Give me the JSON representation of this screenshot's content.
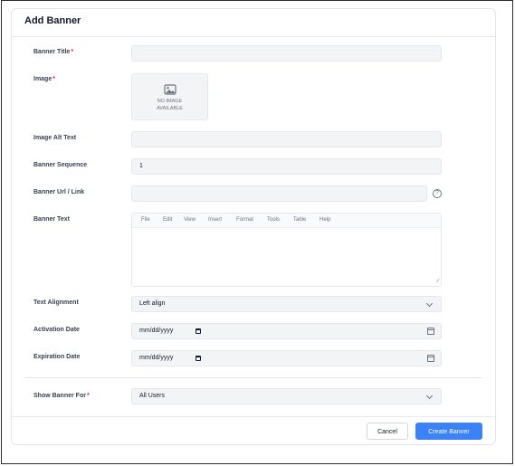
{
  "header": {
    "title": "Add Banner"
  },
  "fields": {
    "banner_title": {
      "label": "Banner Title",
      "required_mark": "*",
      "value": ""
    },
    "image": {
      "label": "Image",
      "required_mark": "*",
      "placeholder_line1": "NO IMAGE",
      "placeholder_line2": "AVAILABLE"
    },
    "image_alt_text": {
      "label": "Image Alt Text",
      "value": ""
    },
    "banner_sequence": {
      "label": "Banner Sequence",
      "value": "1"
    },
    "banner_url": {
      "label": "Banner Url / Link",
      "value": "",
      "help_icon": "question-circle-icon",
      "help_glyph": "?"
    },
    "banner_text": {
      "label": "Banner Text",
      "menu": [
        "File",
        "Edit",
        "View",
        "Insert",
        "Format",
        "Tools",
        "Table",
        "Help"
      ]
    },
    "text_alignment": {
      "label": "Text Alignment",
      "selected": "Left align"
    },
    "activation_date": {
      "label": "Activation Date",
      "placeholder": "mm/dd/yyyy"
    },
    "expiration_date": {
      "label": "Expiration Date",
      "placeholder": "mm/dd/yyyy"
    },
    "show_banner_for": {
      "label": "Show Banner For",
      "required_mark": "*",
      "selected": "All Users"
    }
  },
  "footer": {
    "cancel_label": "Cancel",
    "create_label": "Create Banner"
  },
  "colors": {
    "primary": "#3b82f6",
    "required": "#e11d48",
    "input_bg": "#f3f4f6"
  }
}
